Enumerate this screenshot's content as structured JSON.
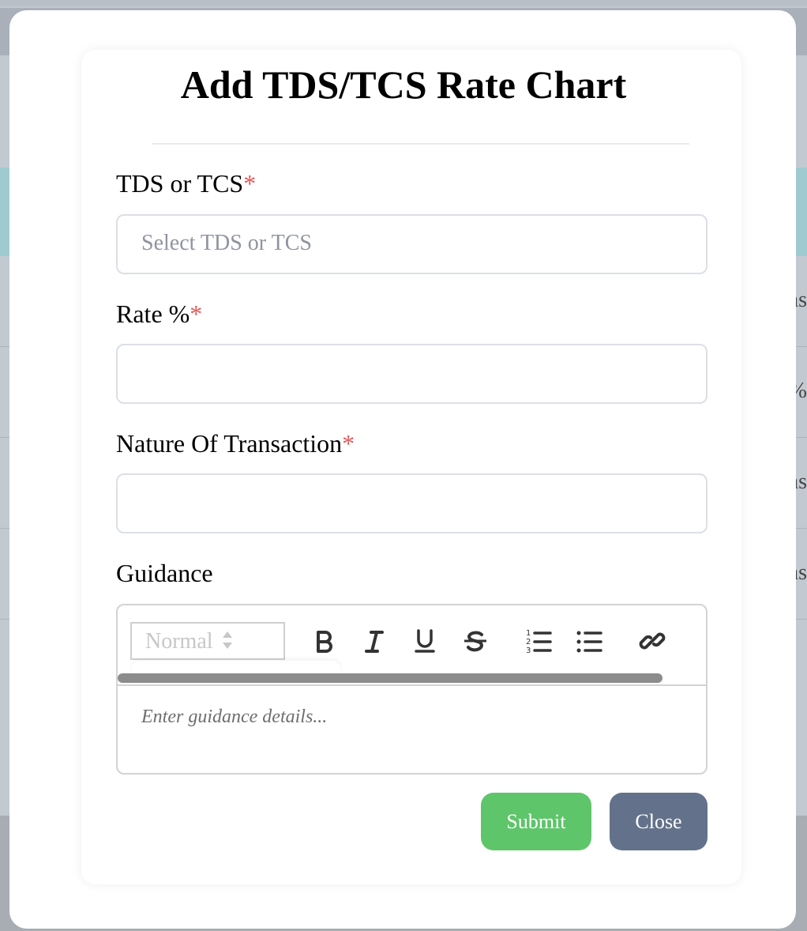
{
  "background": {
    "row_fragments": [
      "ns",
      "%",
      "ns",
      "ns"
    ]
  },
  "modal": {
    "title": "Add TDS/TCS Rate Chart",
    "required_marker": "*",
    "fields": {
      "tds_or_tcs": {
        "label": "TDS or TCS",
        "value": "",
        "placeholder": "Select TDS or TCS"
      },
      "rate": {
        "label": "Rate %",
        "value": ""
      },
      "nature": {
        "label": "Nature Of Transaction",
        "value": ""
      }
    },
    "guidance": {
      "label": "Guidance",
      "format_selected": "Normal",
      "toolbar_icons": [
        "bold-icon",
        "italic-icon",
        "underline-icon",
        "strikethrough-icon",
        "ordered-list-icon",
        "bullet-list-icon",
        "link-icon"
      ],
      "placeholder": "Enter guidance details..."
    },
    "buttons": {
      "submit": "Submit",
      "close": "Close"
    }
  },
  "colors": {
    "required": "#e05a5a",
    "submit": "#5ec56a",
    "close": "#63728a",
    "overlay": "#c3c9d1"
  }
}
